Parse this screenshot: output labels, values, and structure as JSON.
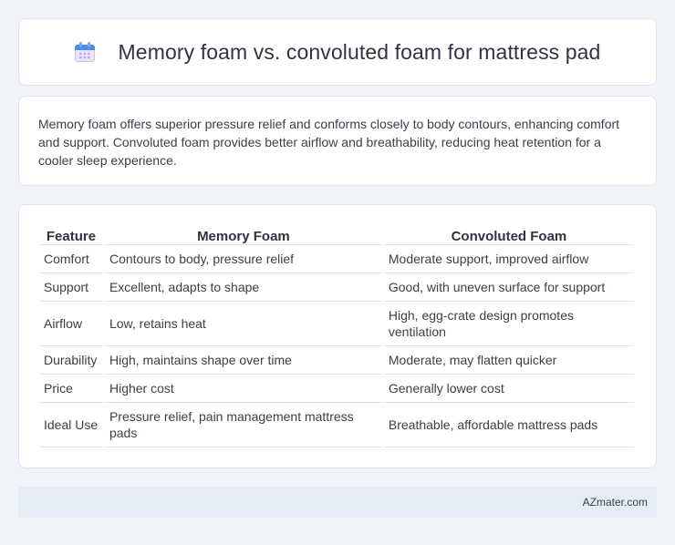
{
  "header": {
    "icon": "calendar-icon",
    "title": "Memory foam vs. convoluted foam for mattress pad"
  },
  "summary": "Memory foam offers superior pressure relief and conforms closely to body contours, enhancing comfort and support. Convoluted foam provides better airflow and breathability, reducing heat retention for a cooler sleep experience.",
  "table": {
    "headers": [
      "Feature",
      "Memory Foam",
      "Convoluted Foam"
    ],
    "rows": [
      [
        "Comfort",
        "Contours to body, pressure relief",
        "Moderate support, improved airflow"
      ],
      [
        "Support",
        "Excellent, adapts to shape",
        "Good, with uneven surface for support"
      ],
      [
        "Airflow",
        "Low, retains heat",
        "High, egg-crate design promotes ventilation"
      ],
      [
        "Durability",
        "High, maintains shape over time",
        "Moderate, may flatten quicker"
      ],
      [
        "Price",
        "Higher cost",
        "Generally lower cost"
      ],
      [
        "Ideal Use",
        "Pressure relief, pain management mattress pads",
        "Breathable, affordable mattress pads"
      ]
    ]
  },
  "footer": {
    "site": "AZmater.com"
  }
}
